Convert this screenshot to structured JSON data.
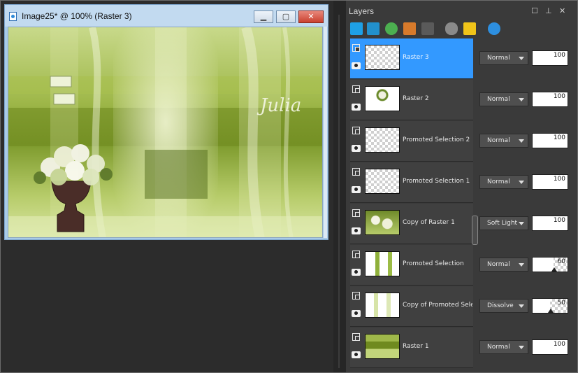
{
  "window": {
    "title": "Image25* @ 100% (Raster 3)",
    "canvas_image": "green-layered-composition-with-flower-vase"
  },
  "panel": {
    "title": "Layers",
    "controls": [
      "maximize-icon",
      "pin-icon",
      "close-icon"
    ],
    "toolbar_icons": [
      "new-raster-layer-icon",
      "new-vector-layer-icon",
      "add-mask-icon",
      "edit-selection-icon",
      "delete-layer-icon",
      "link-icon",
      "lock-icon",
      "layer-properties-icon"
    ]
  },
  "layers": [
    {
      "name": "Raster 3",
      "blend": "Normal",
      "opacity": "100",
      "selected": true,
      "thumb": "transparent"
    },
    {
      "name": "Raster 2",
      "blend": "Normal",
      "opacity": "100",
      "selected": false,
      "thumb": "vase"
    },
    {
      "name": "Promoted Selection 2",
      "blend": "Normal",
      "opacity": "100",
      "selected": false,
      "thumb": "transparent"
    },
    {
      "name": "Promoted Selection 1",
      "blend": "Normal",
      "opacity": "100",
      "selected": false,
      "thumb": "transparent"
    },
    {
      "name": "Copy of Raster 1",
      "blend": "Soft Light",
      "opacity": "100",
      "selected": false,
      "thumb": "flowers"
    },
    {
      "name": "Promoted Selection",
      "blend": "Normal",
      "opacity": "60",
      "selected": false,
      "thumb": "stripes"
    },
    {
      "name": "Copy of Promoted Selecti",
      "blend": "Dissolve",
      "opacity": "50",
      "selected": false,
      "thumb": "stripes-light"
    },
    {
      "name": "Raster 1",
      "blend": "Normal",
      "opacity": "100",
      "selected": false,
      "thumb": "green-pattern"
    }
  ],
  "colors": {
    "selected_row": "#3399ff",
    "panel_bg": "#3a3a3a",
    "workspace_bg": "#2c2c2c"
  }
}
